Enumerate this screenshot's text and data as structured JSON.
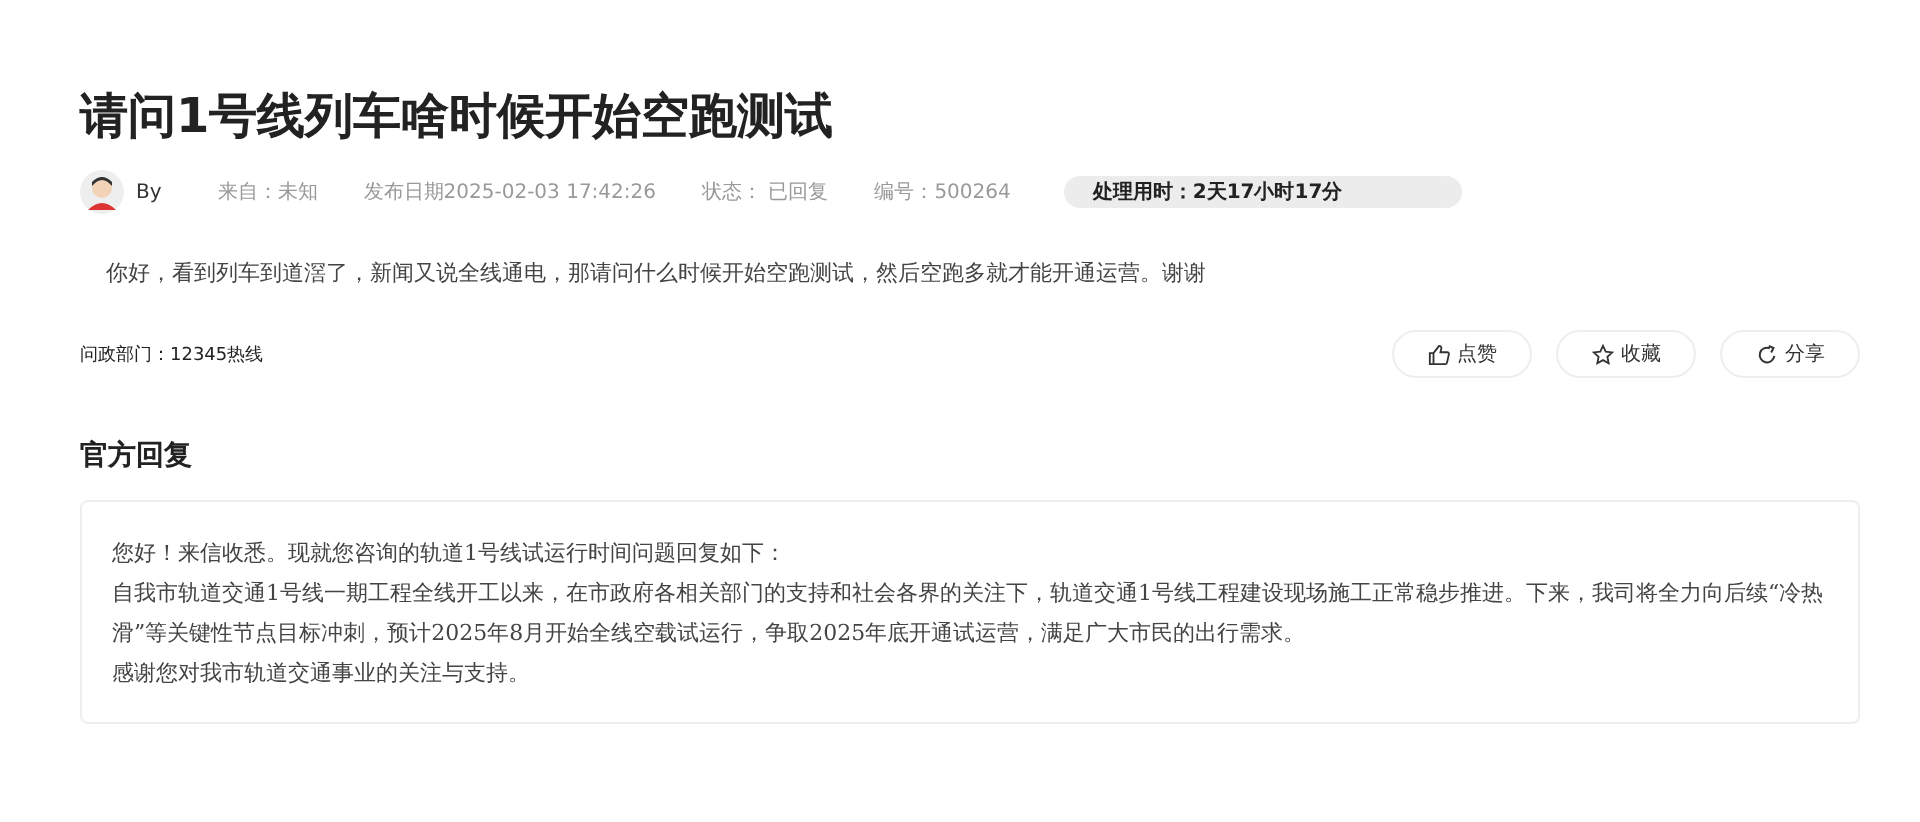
{
  "question": {
    "title": "请问1号线列车啥时候开始空跑测试",
    "author": "By",
    "source": "来自：未知",
    "date": "发布日期2025-02-03 17:42:26",
    "status": "状态：  已回复",
    "number": "编号：500264",
    "duration": "处理用时：2天17小时17分",
    "body": "你好，看到列车到道滘了，新闻又说全线通电，那请问什么时候开始空跑测试，然后空跑多就才能开通运营。谢谢",
    "department": "问政部门：12345热线"
  },
  "actions": [
    {
      "kind": "like",
      "label": "点赞"
    },
    {
      "kind": "star",
      "label": "收藏"
    },
    {
      "kind": "share",
      "label": "分享"
    }
  ],
  "reply": {
    "heading": "官方回复",
    "paragraphs": [
      "您好！来信收悉。现就您咨询的轨道1号线试运行时间问题回复如下：",
      "自我市轨道交通1号线一期工程全线开工以来，在市政府各相关部门的支持和社会各界的关注下，轨道交通1号线工程建设现场施工正常稳步推进。下来，我司将全力向后续“冷热滑”等关键性节点目标冲刺，预计2025年8月开始全线空载试运行，争取2025年底开通试运营，满足广大市民的出行需求。",
      "感谢您对我市轨道交通事业的关注与支持。"
    ]
  }
}
